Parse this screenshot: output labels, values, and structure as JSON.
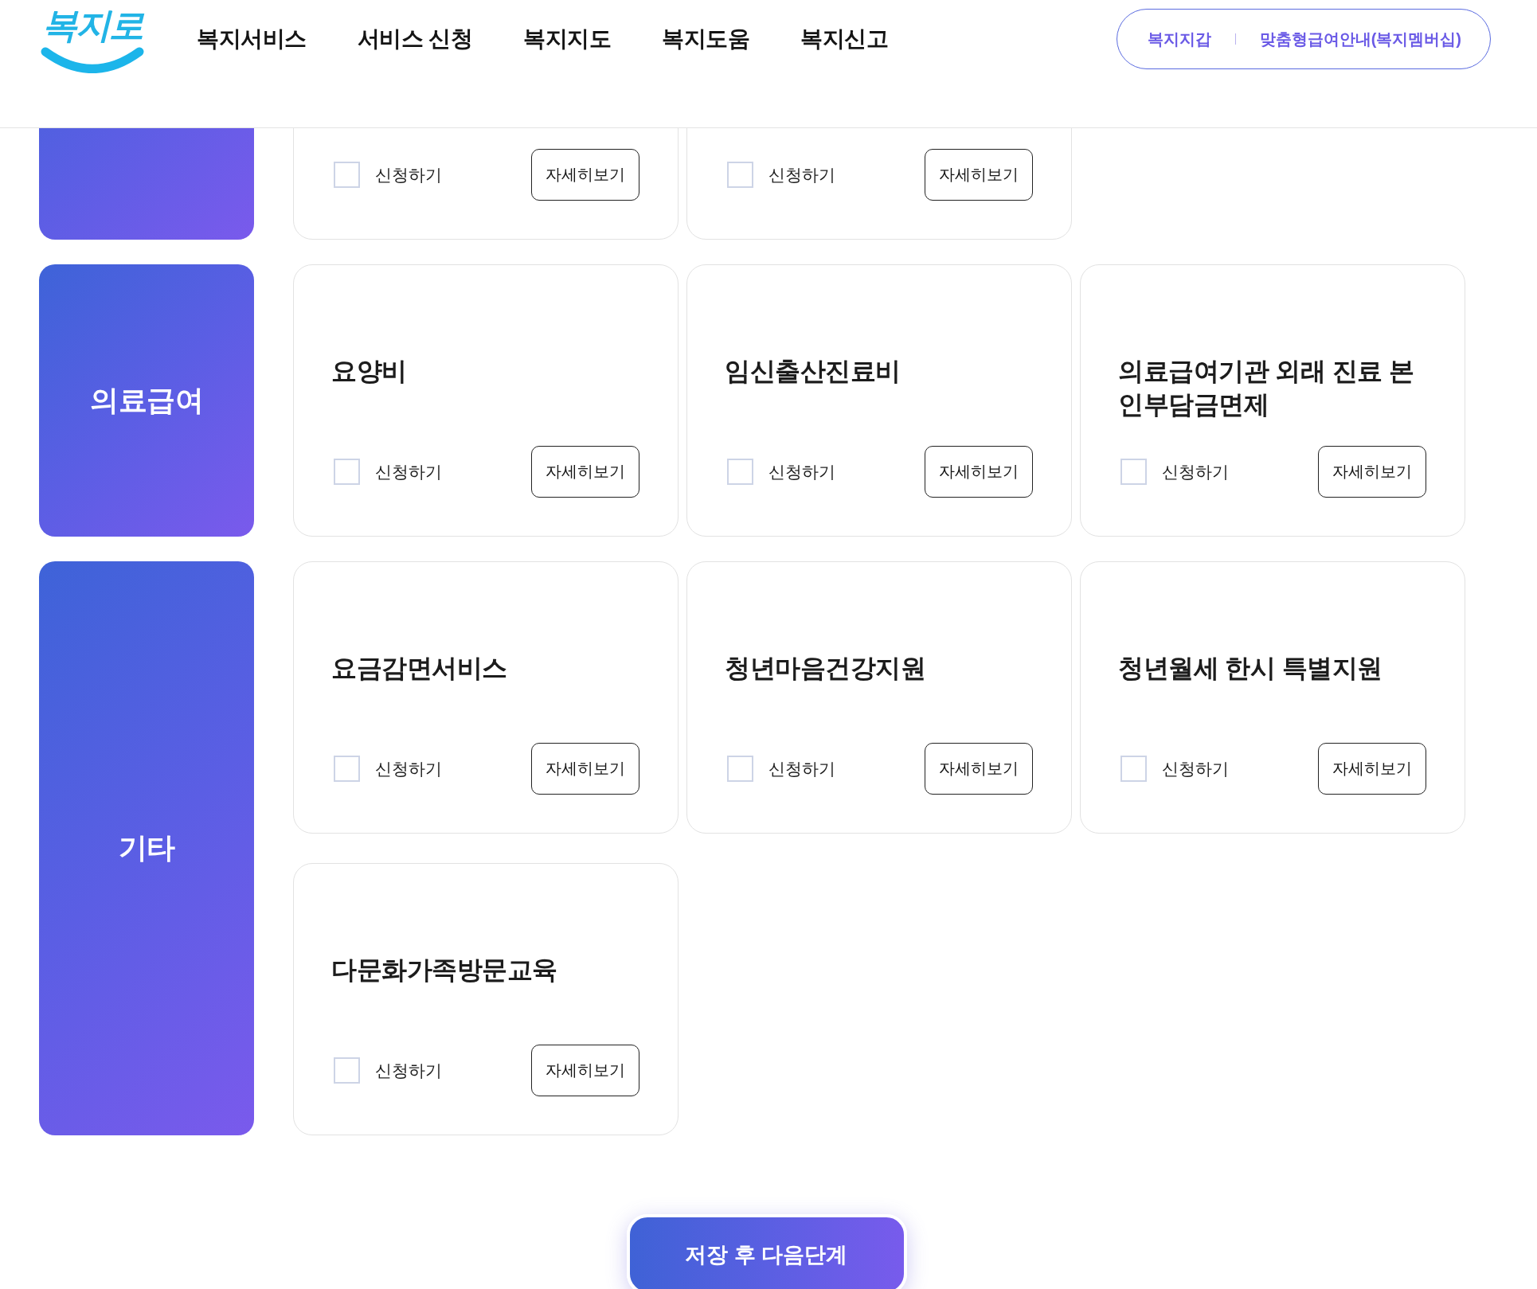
{
  "header": {
    "logo": "복지로",
    "nav": [
      "복지서비스",
      "서비스 신청",
      "복지지도",
      "복지도움",
      "복지신고"
    ],
    "quick_links": [
      "복지지갑",
      "맞춤형급여안내(복지멤버십)"
    ]
  },
  "categories": [
    {
      "cards": [
        {
          "apply_label": "신청하기",
          "checked": false,
          "details_button": "자세히보기"
        },
        {
          "apply_label": "신청하기",
          "checked": false,
          "details_button": "자세히보기"
        }
      ]
    },
    {
      "name": "의료급여",
      "cards": [
        {
          "title": "요양비",
          "apply_label": "신청하기",
          "checked": false,
          "details_button": "자세히보기"
        },
        {
          "title": "임신출산진료비",
          "apply_label": "신청하기",
          "checked": false,
          "details_button": "자세히보기"
        },
        {
          "title": "의료급여기관 외래 진료 본인부담금면제",
          "apply_label": "신청하기",
          "checked": false,
          "details_button": "자세히보기"
        }
      ]
    },
    {
      "name": "기타",
      "cards": [
        {
          "title": "요금감면서비스",
          "apply_label": "신청하기",
          "checked": false,
          "details_button": "자세히보기"
        },
        {
          "title": "청년마음건강지원",
          "apply_label": "신청하기",
          "checked": false,
          "details_button": "자세히보기"
        },
        {
          "title": "청년월세 한시 특별지원",
          "apply_label": "신청하기",
          "checked": false,
          "details_button": "자세히보기"
        },
        {
          "title": "다문화가족방문교육",
          "apply_label": "신청하기",
          "checked": false,
          "details_button": "자세히보기"
        }
      ]
    }
  ],
  "submit_button": "저장 후 다음단계"
}
